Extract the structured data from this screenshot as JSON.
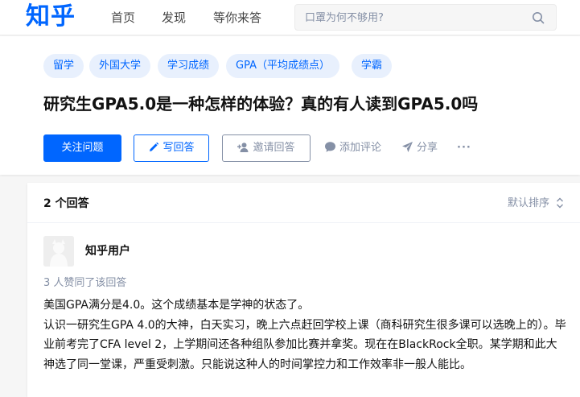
{
  "header": {
    "logo": "知乎",
    "nav": [
      "首页",
      "发现",
      "等你来答"
    ],
    "search_placeholder": "口罩为何不够用?"
  },
  "question": {
    "tags": [
      "留学",
      "外国大学",
      "学习成绩",
      "GPA（平均成绩点）",
      "学霸"
    ],
    "title": "研究生GPA5.0是一种怎样的体验？真的有人读到GPA5.0吗",
    "actions": {
      "follow": "关注问题",
      "write": "写回答",
      "invite": "邀请回答",
      "comment": "添加评论",
      "share": "分享",
      "more": "···"
    }
  },
  "answers": {
    "count_label": "2 个回答",
    "sort_label": "默认排序",
    "first": {
      "author": "知乎用户",
      "votes": "3 人赞同了该回答",
      "paragraphs": [
        "美国GPA满分是4.0。这个成绩基本是学神的状态了。",
        "认识一研究生GPA 4.0的大神，白天实习，晚上六点赶回学校上课（商科研究生很多课可以选晚上的）。毕业前考完了CFA level 2，上学期间还各种组队参加比赛并拿奖。现在在BlackRock全职。某学期和此大神选了同一堂课，严重受刺激。只能说这种人的时间掌控力和工作效率非一般人能比。"
      ]
    }
  },
  "colors": {
    "brand": "#0066ff",
    "tag_bg": "#e8f0fd",
    "muted": "#8590a6",
    "page_bg": "#f6f6f6"
  },
  "icons": [
    "search-icon",
    "pencil-icon",
    "add-user-icon",
    "comment-icon",
    "share-icon",
    "sort-icon",
    "avatar-icon"
  ]
}
